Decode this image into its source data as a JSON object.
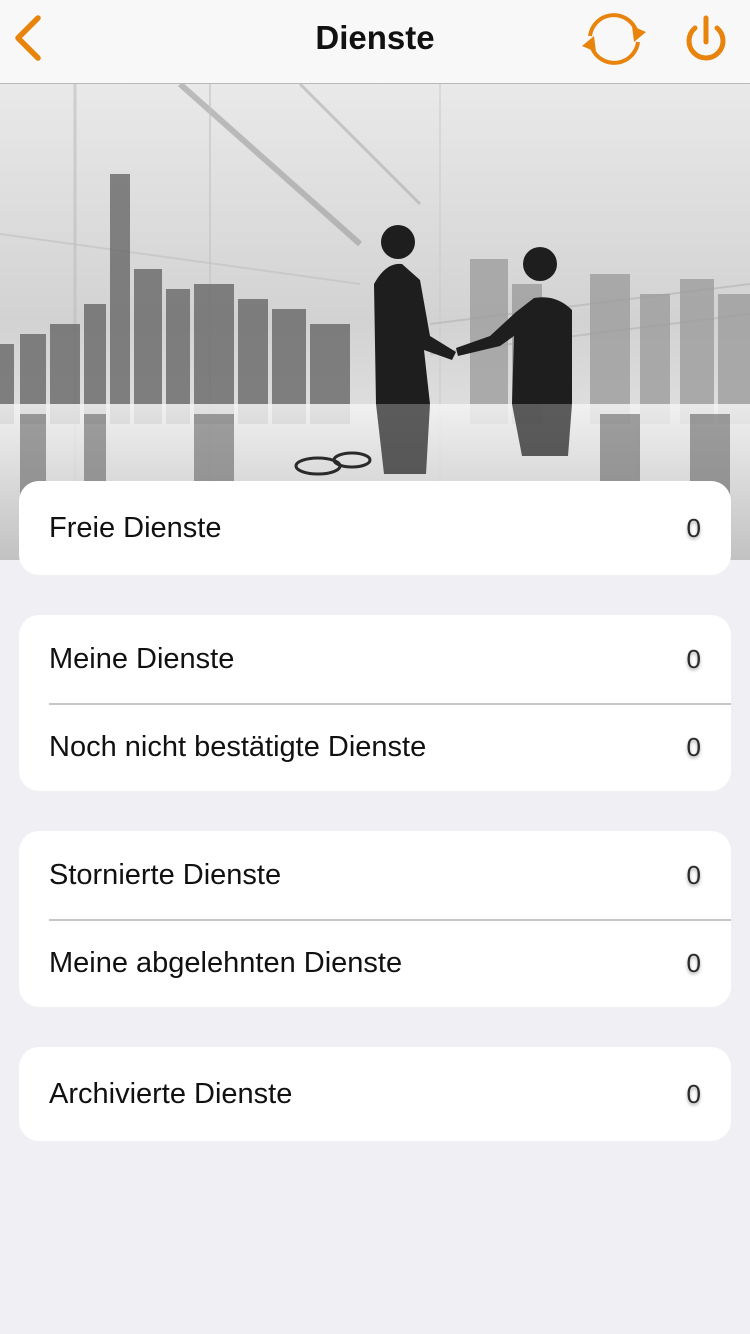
{
  "header": {
    "title": "Dienste",
    "back_icon": "chevron-left-icon",
    "refresh_icon": "refresh-icon",
    "power_icon": "power-icon",
    "accent_color": "#e8830c"
  },
  "hero": {
    "description_icon": "business-handshake-image"
  },
  "groups": [
    {
      "rows": [
        {
          "label": "Freie Dienste",
          "count": "0"
        }
      ]
    },
    {
      "rows": [
        {
          "label": "Meine Dienste",
          "count": "0"
        },
        {
          "label": "Noch nicht bestätigte Dienste",
          "count": "0"
        }
      ]
    },
    {
      "rows": [
        {
          "label": "Stornierte Dienste",
          "count": "0"
        },
        {
          "label": "Meine abgelehnten Dienste",
          "count": "0"
        }
      ]
    },
    {
      "rows": [
        {
          "label": "Archivierte Dienste",
          "count": "0"
        }
      ]
    }
  ]
}
